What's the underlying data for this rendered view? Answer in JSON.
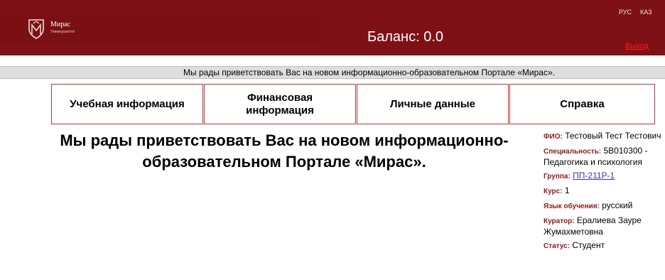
{
  "header": {
    "logo_name": "Мирас",
    "logo_sub": "Университеті",
    "balance": "Баланс: 0.0",
    "lang_ru": "РУС",
    "lang_kz": "КАЗ",
    "logout": "Выход",
    "bg_color": "#7e1115"
  },
  "marquee": {
    "text": "Мы рады приветствовать Вас на новом информационно-образовательном Портале «Мирас»."
  },
  "nav": [
    {
      "label": "Учебная информация"
    },
    {
      "label": "Финансовая информация"
    },
    {
      "label": "Личные данные"
    },
    {
      "label": "Справка"
    }
  ],
  "main": {
    "welcome": "Мы рады приветствовать Вас на новом информационно-образовательном Портале «Мирас»."
  },
  "student": {
    "fio_label": "ФИО:",
    "fio": "Тестовый Тест Тестович",
    "spec_label": "Специальность:",
    "spec": "5В010300 - Педагогика и психология",
    "group_label": "Группа:",
    "group": "ПП-211Р-1",
    "course_label": "Курс:",
    "course": "1",
    "lang_label": "Язык обучения:",
    "lang": "русский",
    "curator_label": "Куратор:",
    "curator": "Ералиева Зауре Жумахметовна",
    "status_label": "Статус:",
    "status": "Студент"
  }
}
